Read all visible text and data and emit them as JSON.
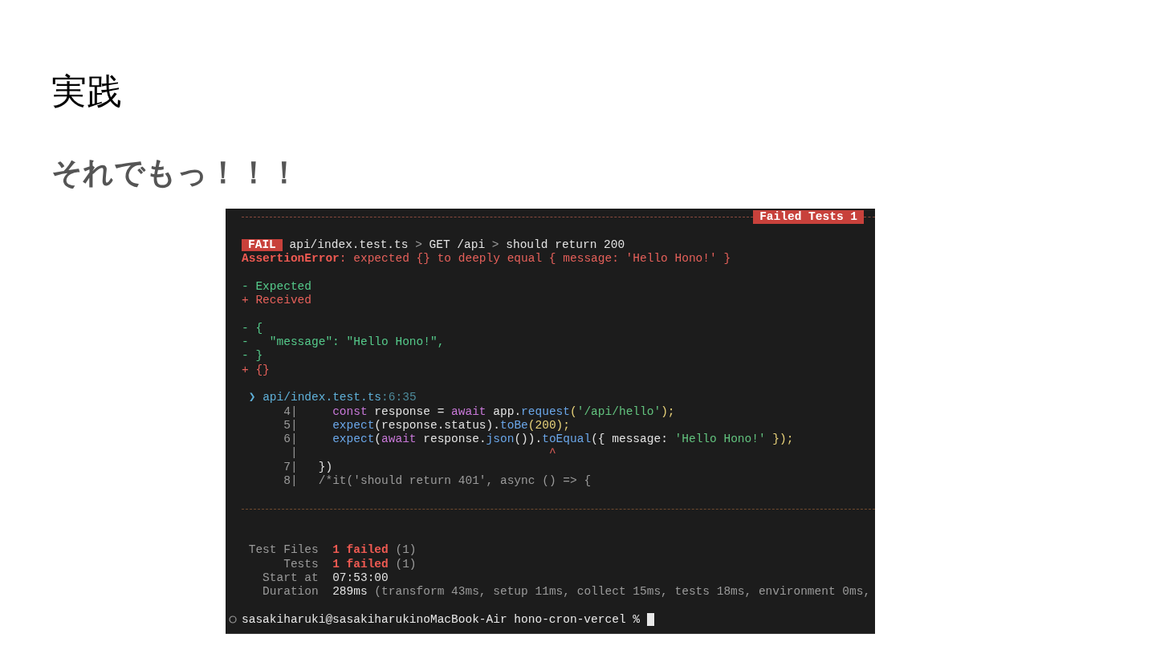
{
  "slide": {
    "title": "実践",
    "subtitle": "それでもっ！！！"
  },
  "terminal": {
    "banner": "Failed Tests 1",
    "blocks": [
      [
        {
          "badge": "FAIL",
          "segments": [
            {
              "text": " api/index.test.ts ",
              "kind": "plain"
            },
            {
              "text": ">",
              "kind": "dim"
            },
            {
              "text": " GET /api ",
              "kind": "plain"
            },
            {
              "text": ">",
              "kind": "dim"
            },
            {
              "text": " should return 200",
              "kind": "plain"
            }
          ]
        },
        {
          "segments": [
            {
              "text": "AssertionError",
              "kind": "red-bold"
            },
            {
              "text": ": expected {} to deeply equal { message: 'Hello Hono!' }",
              "kind": "red"
            }
          ]
        }
      ],
      [
        {
          "segments": [
            {
              "text": "- Expected",
              "kind": "green"
            }
          ]
        },
        {
          "segments": [
            {
              "text": "+ Received",
              "kind": "red"
            }
          ]
        }
      ],
      [
        {
          "segments": [
            {
              "text": "- {",
              "kind": "green"
            }
          ]
        },
        {
          "segments": [
            {
              "text": "-   \"message\": \"Hello Hono!\",",
              "kind": "green"
            }
          ]
        },
        {
          "segments": [
            {
              "text": "- }",
              "kind": "green"
            }
          ]
        },
        {
          "segments": [
            {
              "text": "+ {}",
              "kind": "red"
            }
          ]
        }
      ],
      [
        {
          "segments": [
            {
              "text": " ❯ ",
              "kind": "path"
            },
            {
              "text": "api/index.test.ts",
              "kind": "path"
            },
            {
              "text": ":6:35",
              "kind": "position"
            }
          ]
        },
        {
          "segments": [
            {
              "text": "      4|",
              "kind": "dim"
            },
            {
              "text": "     const",
              "kind": "keyword"
            },
            {
              "text": " response = ",
              "kind": "plain"
            },
            {
              "text": "await",
              "kind": "keyword"
            },
            {
              "text": " app.",
              "kind": "plain"
            },
            {
              "text": "request",
              "kind": "func"
            },
            {
              "text": "(",
              "kind": "punct"
            },
            {
              "text": "'/api/hello'",
              "kind": "string"
            },
            {
              "text": ");",
              "kind": "punct"
            }
          ]
        },
        {
          "segments": [
            {
              "text": "      5|",
              "kind": "dim"
            },
            {
              "text": "     expect",
              "kind": "func"
            },
            {
              "text": "(response.status).",
              "kind": "plain"
            },
            {
              "text": "toBe",
              "kind": "func"
            },
            {
              "text": "(200);",
              "kind": "punct"
            }
          ]
        },
        {
          "segments": [
            {
              "text": "      6|",
              "kind": "dim"
            },
            {
              "text": "     expect",
              "kind": "func"
            },
            {
              "text": "(",
              "kind": "plain"
            },
            {
              "text": "await",
              "kind": "keyword"
            },
            {
              "text": " response.",
              "kind": "plain"
            },
            {
              "text": "json",
              "kind": "func"
            },
            {
              "text": "()).",
              "kind": "plain"
            },
            {
              "text": "toEqual",
              "kind": "func"
            },
            {
              "text": "({ message: ",
              "kind": "plain"
            },
            {
              "text": "'Hello Hono!'",
              "kind": "string"
            },
            {
              "text": " });",
              "kind": "punct"
            }
          ]
        },
        {
          "segments": [
            {
              "text": "       |",
              "kind": "dim"
            },
            {
              "text": "                                    ^",
              "kind": "caret"
            }
          ]
        },
        {
          "segments": [
            {
              "text": "      7|",
              "kind": "dim"
            },
            {
              "text": "   })",
              "kind": "plain"
            }
          ]
        },
        {
          "segments": [
            {
              "text": "      8|",
              "kind": "dim"
            },
            {
              "text": "   /*it('should return 401', async () => {",
              "kind": "dim"
            }
          ]
        }
      ]
    ],
    "summary": [
      {
        "segments": [
          {
            "text": " Test Files  ",
            "kind": "dim"
          },
          {
            "text": "1 failed",
            "kind": "red-bold"
          },
          {
            "text": " (1)",
            "kind": "dim"
          }
        ]
      },
      {
        "segments": [
          {
            "text": "      Tests  ",
            "kind": "dim"
          },
          {
            "text": "1 failed",
            "kind": "red-bold"
          },
          {
            "text": " (1)",
            "kind": "dim"
          }
        ]
      },
      {
        "segments": [
          {
            "text": "   Start at  ",
            "kind": "dim"
          },
          {
            "text": "07:53:00",
            "kind": "plain"
          }
        ]
      },
      {
        "segments": [
          {
            "text": "   Duration  ",
            "kind": "dim"
          },
          {
            "text": "289ms",
            "kind": "plain"
          },
          {
            "text": " (transform 43ms, setup 11ms, collect 15ms, tests 18ms, environment 0ms,",
            "kind": "dim"
          }
        ]
      }
    ],
    "prompt": "sasakiharuki@sasakiharukinoMacBook-Air hono-cron-vercel %"
  }
}
